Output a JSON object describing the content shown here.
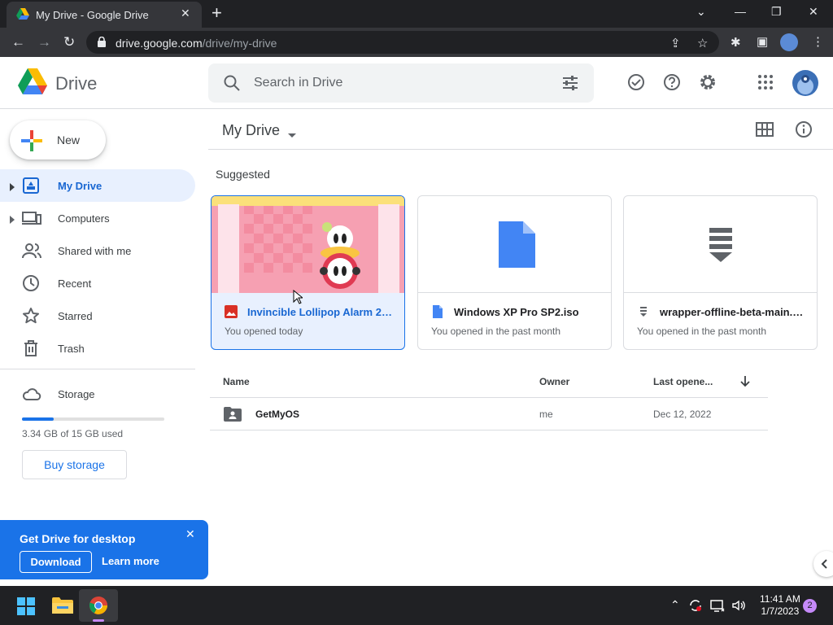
{
  "browser": {
    "tab_title": "My Drive - Google Drive",
    "url_host": "drive.google.com",
    "url_path": "/drive/my-drive"
  },
  "header": {
    "logo_text": "Drive",
    "search_placeholder": "Search in Drive"
  },
  "sidebar": {
    "new_label": "New",
    "items": [
      {
        "label": "My Drive",
        "icon": "my-drive-icon"
      },
      {
        "label": "Computers",
        "icon": "computers-icon"
      },
      {
        "label": "Shared with me",
        "icon": "shared-icon"
      },
      {
        "label": "Recent",
        "icon": "clock-icon"
      },
      {
        "label": "Starred",
        "icon": "star-icon"
      },
      {
        "label": "Trash",
        "icon": "trash-icon"
      }
    ],
    "storage_label": "Storage",
    "storage_used_fraction": 0.223,
    "storage_text": "3.34 GB of 15 GB used",
    "buy_label": "Buy storage"
  },
  "promo": {
    "title": "Get Drive for desktop",
    "download_label": "Download",
    "learn_label": "Learn more"
  },
  "main": {
    "title": "My Drive",
    "suggested_label": "Suggested",
    "cards": [
      {
        "name": "Invincible Lollipop Alarm 20...",
        "sub": "You opened today"
      },
      {
        "name": "Windows XP Pro SP2.iso",
        "sub": "You opened in the past month"
      },
      {
        "name": "wrapper-offline-beta-main.rar",
        "sub": "You opened in the past month"
      }
    ],
    "columns": {
      "name": "Name",
      "owner": "Owner",
      "last_opened": "Last opene..."
    },
    "rows": [
      {
        "name": "GetMyOS",
        "owner": "me",
        "date": "Dec 12, 2022"
      }
    ]
  },
  "taskbar": {
    "time": "11:41 AM",
    "date": "1/7/2023",
    "notifications": "2"
  },
  "colors": {
    "accent": "#1a73e8",
    "selected_bg": "#e8f0fe"
  }
}
